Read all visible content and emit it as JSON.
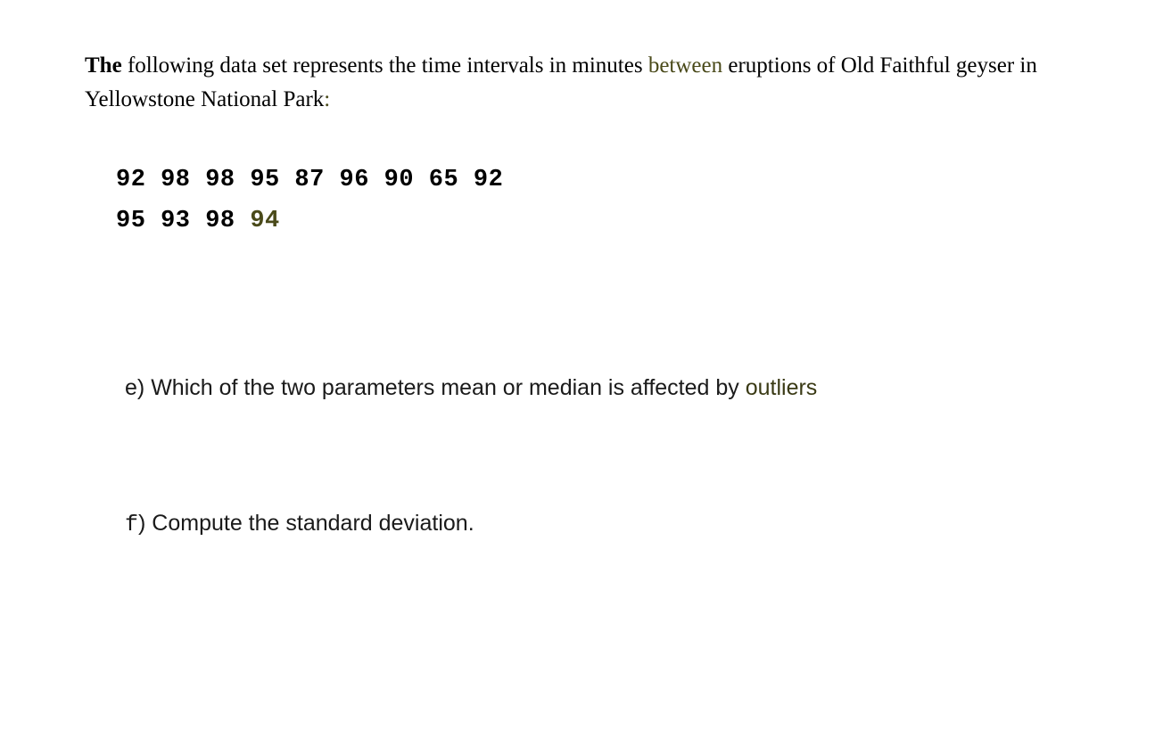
{
  "intro": {
    "bold_start": "The",
    "part1": " following data set represents the time intervals in minutes ",
    "between": "between",
    "part2": " eruptions of Old Faithful geyser in Yellowstone National Park",
    "colon": ":"
  },
  "data": {
    "line1": "92 98 98  95  87  96  90  65  92",
    "line2_part1": "95  93  98  ",
    "line2_olive": "94"
  },
  "question_e": {
    "label": "e) ",
    "text": "Which of the two parameters mean or median is affected by ",
    "outliers": "outliers"
  },
  "question_f": {
    "label_letter": "f",
    "label_rest": ") ",
    "text": "Compute the standard deviation."
  }
}
